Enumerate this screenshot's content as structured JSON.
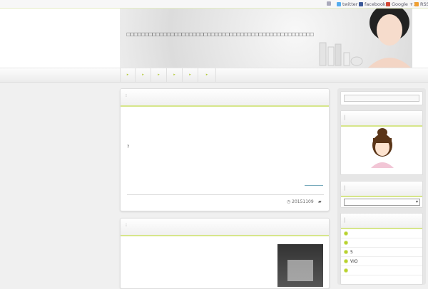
{
  "topbar": {
    "links": [
      {
        "label": "",
        "icon": "home-icon"
      },
      {
        "label": "twitter",
        "icon": "twitter-icon"
      },
      {
        "label": "facebook",
        "icon": "facebook-icon"
      },
      {
        "label": "Google +1",
        "icon": "google-plus-icon"
      },
      {
        "label": "RSS",
        "icon": "rss-icon"
      }
    ]
  },
  "header": {
    "tagline": "□□□□□□□□□□□□□□□□□□□□□□□□□□□□□□□□□□□□□□□□□□□□□□□□□□□"
  },
  "nav": {
    "items": [
      "▸",
      "▸",
      "▸",
      "▸",
      "▸",
      "▸"
    ]
  },
  "posts": [
    {
      "title": "",
      "excerpt": "?",
      "more_link": "",
      "date": "20151109",
      "category": ""
    },
    {
      "title": ""
    }
  ],
  "sidebar": {
    "search": {
      "placeholder": ""
    },
    "select": {
      "value": ""
    },
    "list": [
      "",
      "",
      "5",
      "VIO",
      ""
    ]
  },
  "colors": {
    "accent": "#b8d12a"
  }
}
